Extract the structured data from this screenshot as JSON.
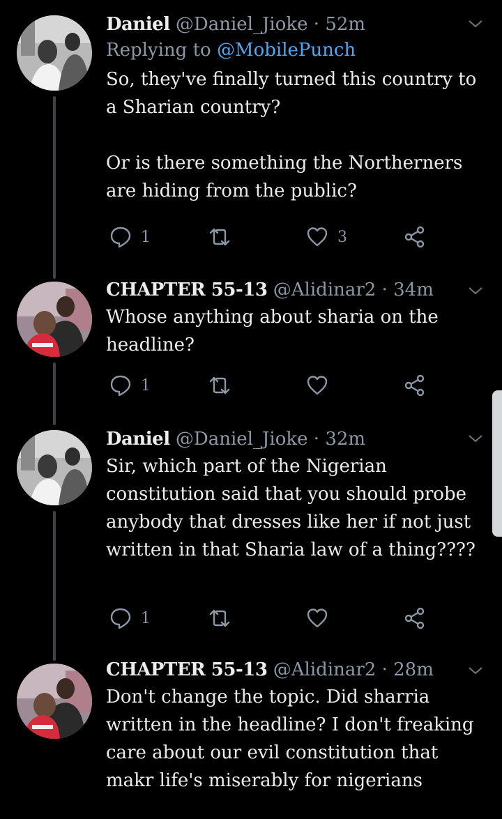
{
  "colors": {
    "background": "#000000",
    "text": "#ececec",
    "muted": "#8b98a5",
    "link": "#4ea8f4",
    "thread_line": "#3d4247"
  },
  "tweets": [
    {
      "name": "Daniel",
      "handle": "@Daniel_Jioke",
      "separator": "·",
      "time": "52m",
      "replying_prefix": "Replying to ",
      "replying_to": "@MobilePunch",
      "text": "So, they've finally turned this country to a Sharian country?\n\nOr is there something the Northerners are hiding from the public?",
      "reply_count": "1",
      "retweet_count": "",
      "like_count": "3",
      "avatar_icon": "user-avatar-photo"
    },
    {
      "name": "CHAPTER 55-13",
      "handle": "@Alidinar2",
      "separator": "·",
      "time": "34m",
      "text": "Whose anything about sharia on the headline?",
      "reply_count": "1",
      "retweet_count": "",
      "like_count": "",
      "avatar_icon": "user-avatar-photo"
    },
    {
      "name": "Daniel",
      "handle": "@Daniel_Jioke",
      "separator": "·",
      "time": "32m",
      "text": "Sir, which part of the Nigerian constitution said that you should probe anybody that dresses like her if not just written in that Sharia law of a thing????",
      "reply_count": "1",
      "retweet_count": "",
      "like_count": "",
      "avatar_icon": "user-avatar-photo"
    },
    {
      "name": "CHAPTER 55-13",
      "handle": "@Alidinar2",
      "separator": "·",
      "time": "28m",
      "text": "Don't change the topic. Did sharria written in the headline? I don't freaking care about our evil constitution that makr life's miserably for nigerians",
      "avatar_icon": "user-avatar-photo"
    }
  ]
}
